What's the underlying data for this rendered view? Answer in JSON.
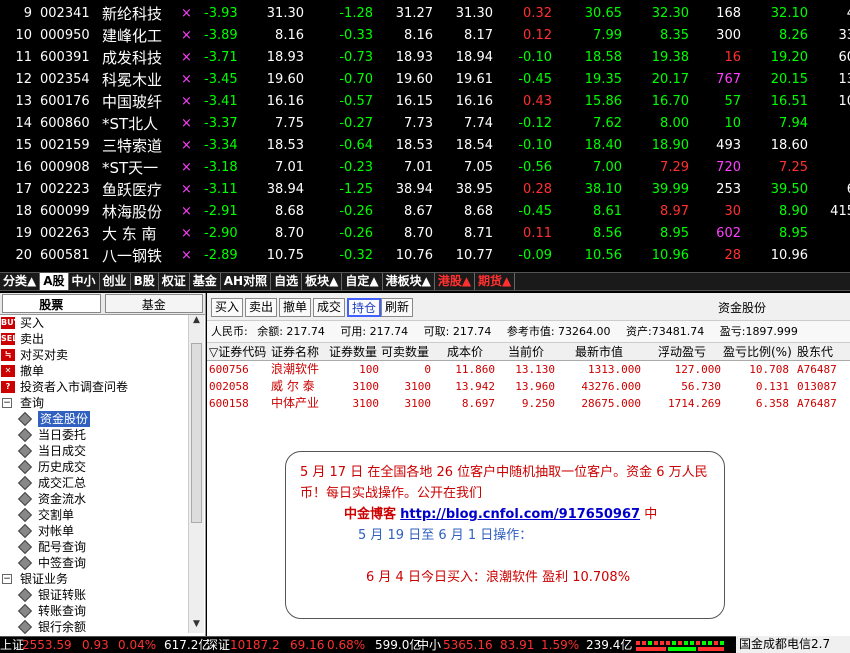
{
  "quotes": [
    {
      "idx": "9",
      "code": "002341",
      "name": "新纶科技",
      "mark": "×",
      "chg": "-3.93",
      "v1": "31.30",
      "v2": "-1.28",
      "v3": "31.27",
      "v4": "31.30",
      "v5": "0.32",
      "v6": "30.65",
      "v7": "32.30",
      "v8": "168",
      "v9": "32.10",
      "v10": "4",
      "c5": "red",
      "c7": "green",
      "c8": "white",
      "c9": "green"
    },
    {
      "idx": "10",
      "code": "000950",
      "name": "建峰化工",
      "mark": "×",
      "chg": "-3.89",
      "v1": "8.16",
      "v2": "-0.33",
      "v3": "8.16",
      "v4": "8.17",
      "v5": "0.12",
      "v6": "7.99",
      "v7": "8.35",
      "v8": "300",
      "v9": "8.26",
      "v10": "33",
      "c5": "red",
      "c7": "green",
      "c8": "white",
      "c9": "green"
    },
    {
      "idx": "11",
      "code": "600391",
      "name": "成发科技",
      "mark": "×",
      "chg": "-3.71",
      "v1": "18.93",
      "v2": "-0.73",
      "v3": "18.93",
      "v4": "18.94",
      "v5": "-0.10",
      "v6": "18.58",
      "v7": "19.38",
      "v8": "16",
      "v9": "19.20",
      "v10": "60",
      "c5": "green",
      "c7": "green",
      "c8": "red",
      "c9": "green"
    },
    {
      "idx": "12",
      "code": "002354",
      "name": "科冕木业",
      "mark": "×",
      "chg": "-3.45",
      "v1": "19.60",
      "v2": "-0.70",
      "v3": "19.60",
      "v4": "19.61",
      "v5": "-0.45",
      "v6": "19.35",
      "v7": "20.17",
      "v8": "767",
      "v9": "20.15",
      "v10": "13",
      "c5": "green",
      "c7": "green",
      "c8": "mag",
      "c9": "green"
    },
    {
      "idx": "13",
      "code": "600176",
      "name": "中国玻纤",
      "mark": "×",
      "chg": "-3.41",
      "v1": "16.16",
      "v2": "-0.57",
      "v3": "16.15",
      "v4": "16.16",
      "v5": "0.43",
      "v6": "15.86",
      "v7": "16.70",
      "v8": "57",
      "v9": "16.51",
      "v10": "10",
      "c5": "red",
      "c7": "green",
      "c8": "green",
      "c9": "green"
    },
    {
      "idx": "14",
      "code": "600860",
      "name": "*ST北人",
      "mark": "×",
      "chg": "-3.37",
      "v1": "7.75",
      "v2": "-0.27",
      "v3": "7.73",
      "v4": "7.74",
      "v5": "-0.12",
      "v6": "7.62",
      "v7": "8.00",
      "v8": "10",
      "v9": "7.94",
      "v10": "",
      "c5": "green",
      "c7": "green",
      "c8": "green",
      "c9": "green"
    },
    {
      "idx": "15",
      "code": "002159",
      "name": "三特索道",
      "mark": "×",
      "chg": "-3.34",
      "v1": "18.53",
      "v2": "-0.64",
      "v3": "18.53",
      "v4": "18.54",
      "v5": "-0.10",
      "v6": "18.40",
      "v7": "18.90",
      "v8": "493",
      "v9": "18.60",
      "v10": "",
      "c5": "green",
      "c7": "green",
      "c8": "white",
      "c9": "white"
    },
    {
      "idx": "16",
      "code": "000908",
      "name": "*ST天一",
      "mark": "×",
      "chg": "-3.18",
      "v1": "7.01",
      "v2": "-0.23",
      "v3": "7.01",
      "v4": "7.05",
      "v5": "-0.56",
      "v6": "7.00",
      "v7": "7.29",
      "v8": "720",
      "v9": "7.25",
      "v10": "",
      "c5": "green",
      "c7": "red",
      "c8": "mag",
      "c9": "red"
    },
    {
      "idx": "17",
      "code": "002223",
      "name": "鱼跃医疗",
      "mark": "×",
      "chg": "-3.11",
      "v1": "38.94",
      "v2": "-1.25",
      "v3": "38.94",
      "v4": "38.95",
      "v5": "0.28",
      "v6": "38.10",
      "v7": "39.99",
      "v8": "253",
      "v9": "39.50",
      "v10": "6",
      "c5": "red",
      "c7": "green",
      "c8": "white",
      "c9": "green"
    },
    {
      "idx": "18",
      "code": "600099",
      "name": "林海股份",
      "mark": "×",
      "chg": "-2.91",
      "v1": "8.68",
      "v2": "-0.26",
      "v3": "8.67",
      "v4": "8.68",
      "v5": "-0.45",
      "v6": "8.61",
      "v7": "8.97",
      "v8": "30",
      "v9": "8.90",
      "v10": "415",
      "c5": "green",
      "c7": "red",
      "c8": "red",
      "c9": "green"
    },
    {
      "idx": "19",
      "code": "002263",
      "name": "大 东 南",
      "mark": "×",
      "chg": "-2.90",
      "v1": "8.70",
      "v2": "-0.26",
      "v3": "8.70",
      "v4": "8.71",
      "v5": "0.11",
      "v6": "8.56",
      "v7": "8.95",
      "v8": "602",
      "v9": "8.95",
      "v10": "",
      "c5": "red",
      "c7": "green",
      "c8": "mag",
      "c9": "green"
    },
    {
      "idx": "20",
      "code": "600581",
      "name": "八一钢铁",
      "mark": "×",
      "chg": "-2.89",
      "v1": "10.75",
      "v2": "-0.32",
      "v3": "10.76",
      "v4": "10.77",
      "v5": "-0.09",
      "v6": "10.56",
      "v7": "10.96",
      "v8": "28",
      "v9": "10.96",
      "v10": "",
      "c5": "green",
      "c7": "green",
      "c8": "red",
      "c9": "white"
    }
  ],
  "tabs": [
    {
      "label": "分类▲",
      "state": ""
    },
    {
      "label": "A股",
      "state": "active"
    },
    {
      "label": "中小",
      "state": ""
    },
    {
      "label": "创业",
      "state": ""
    },
    {
      "label": "B股",
      "state": ""
    },
    {
      "label": "权证",
      "state": ""
    },
    {
      "label": "基金",
      "state": ""
    },
    {
      "label": "AH对照",
      "state": ""
    },
    {
      "label": "自选",
      "state": ""
    },
    {
      "label": "板块▲",
      "state": ""
    },
    {
      "label": "自定▲",
      "state": ""
    },
    {
      "label": "港板块▲",
      "state": ""
    },
    {
      "label": "港股▲",
      "state": "hot"
    },
    {
      "label": "期货▲",
      "state": "hot"
    }
  ],
  "left_tabs": [
    "股票",
    "基金"
  ],
  "tree": [
    {
      "label": "买入",
      "type": "icon",
      "icon": "BUY",
      "level": 0
    },
    {
      "label": "卖出",
      "type": "icon",
      "icon": "SELL",
      "level": 0
    },
    {
      "label": "对买对卖",
      "type": "icon",
      "icon": "≒",
      "level": 0
    },
    {
      "label": "撤单",
      "type": "icon",
      "icon": "✕",
      "level": 0
    },
    {
      "label": "投资者入市调查问卷",
      "type": "icon",
      "icon": "?",
      "level": 0
    },
    {
      "label": "查询",
      "type": "exp",
      "icon": "−",
      "level": 0
    },
    {
      "label": "资金股份",
      "type": "dia",
      "level": 1,
      "selected": true
    },
    {
      "label": "当日委托",
      "type": "dia",
      "level": 1
    },
    {
      "label": "当日成交",
      "type": "dia",
      "level": 1
    },
    {
      "label": "历史成交",
      "type": "dia",
      "level": 1
    },
    {
      "label": "成交汇总",
      "type": "dia",
      "level": 1
    },
    {
      "label": "资金流水",
      "type": "dia",
      "level": 1
    },
    {
      "label": "交割单",
      "type": "dia",
      "level": 1
    },
    {
      "label": "对帐单",
      "type": "dia",
      "level": 1
    },
    {
      "label": "配号查询",
      "type": "dia",
      "level": 1
    },
    {
      "label": "中签查询",
      "type": "dia",
      "level": 1
    },
    {
      "label": "银证业务",
      "type": "exp",
      "icon": "−",
      "level": 0
    },
    {
      "label": "银证转账",
      "type": "dia",
      "level": 1
    },
    {
      "label": "转账查询",
      "type": "dia",
      "level": 1
    },
    {
      "label": "银行余额",
      "type": "dia",
      "level": 1
    }
  ],
  "toolbar": {
    "buttons": [
      "买入",
      "卖出",
      "撤单",
      "成交",
      "持仓",
      "刷新"
    ],
    "active": "持仓",
    "title": "资金股份"
  },
  "account": {
    "currency": "人民币:",
    "balance": "余额: 217.74",
    "available": "可用: 217.74",
    "withdrawable": "可取: 217.74",
    "ref_mv": "参考市值: 73264.00",
    "assets": "资产:73481.74",
    "pnl": "盈亏:1897.999"
  },
  "grid": {
    "headers": [
      "▽证券代码",
      "证券名称",
      "证券数量",
      "可卖数量",
      "成本价",
      "当前价",
      "最新市值",
      "浮动盈亏",
      "盈亏比例(%)",
      "股东代"
    ],
    "rows": [
      [
        "600756",
        "浪潮软件",
        "100",
        "0",
        "11.860",
        "13.130",
        "1313.000",
        "127.000",
        "10.708",
        "A76487"
      ],
      [
        "002058",
        "威 尔 泰",
        "3100",
        "3100",
        "13.942",
        "13.960",
        "43276.000",
        "56.730",
        "0.131",
        "013087"
      ],
      [
        "600158",
        "中体产业",
        "3100",
        "3100",
        "8.697",
        "9.250",
        "28675.000",
        "1714.269",
        "6.358",
        "A76487"
      ]
    ]
  },
  "notice": {
    "line1": "5 月 17 日  在全国各地 26 位客户中随机抽取一位客户。资金 6 万人民币！每日实战操作。公开在我们",
    "blog": "中金博客",
    "url": "http://blog.cnfol.com/917650967",
    "blog_suffix": " 中",
    "line2": "5 月 19 日至 6 月 1 日操作：",
    "line3": "6 月 4 日今日买入：浪潮软件 盈利 10.708%"
  },
  "status": {
    "sh_label": "上证",
    "sh_val": "2553.59",
    "sh_chg": "0.93",
    "sh_pct": "0.04%",
    "sh_amt": "617.2亿",
    "sz_label": "深证",
    "sz_val": "10187.2",
    "sz_chg": "69.16",
    "sz_pct": "0.68%",
    "sz_amt": "599.0亿",
    "zx_label": "中小",
    "zx_val": "5365.16",
    "zx_chg": "83.91",
    "zx_pct": "1.59%",
    "zx_amt": "239.4亿",
    "broker": "国金成都电信2.7"
  }
}
